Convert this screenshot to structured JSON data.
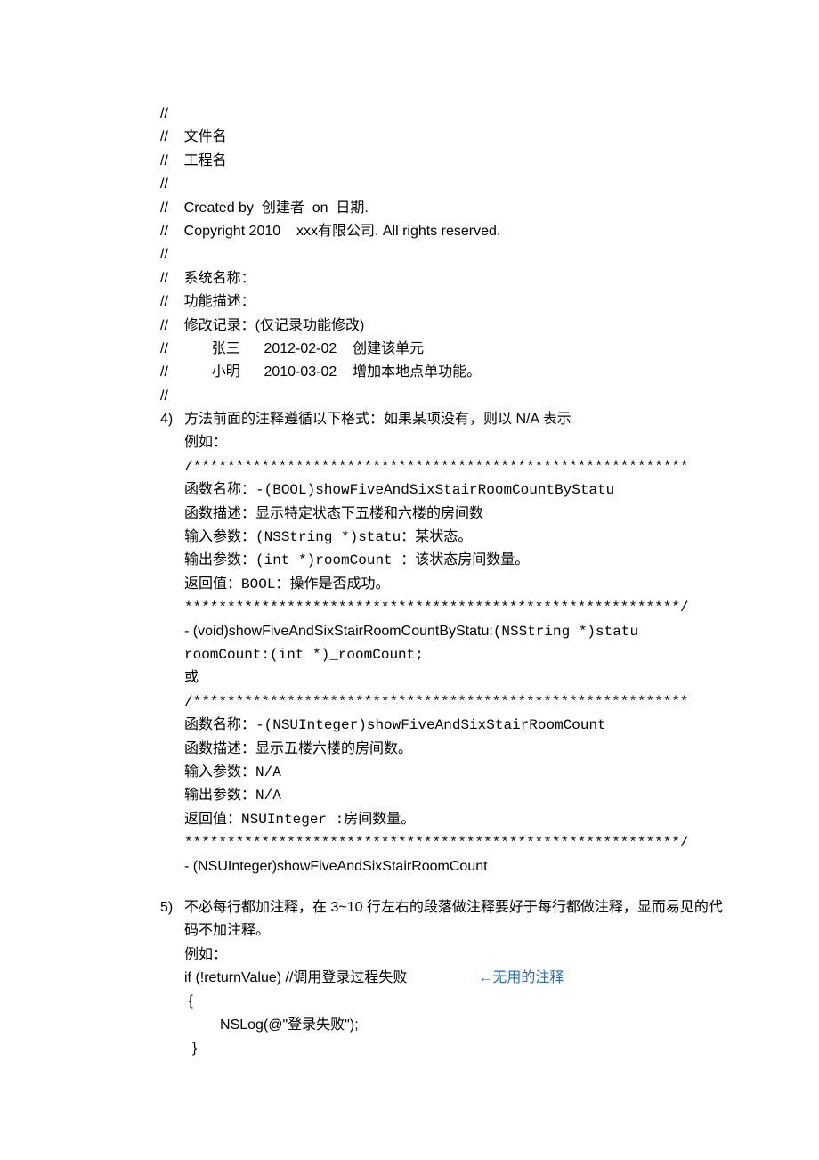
{
  "header": {
    "l1": "//",
    "l2": "//    文件名",
    "l3": "//    工程名",
    "l4": "//",
    "l5": "//    Created by  创建者  on  日期.",
    "l6": "//    Copyright 2010    xxx有限公司. All rights reserved.",
    "l7": "//",
    "l8": "//    系统名称：",
    "l9": "//    功能描述：",
    "l10": "//    修改记录：(仅记录功能修改)",
    "l11": "//           张三      2012-02-02    创建该单元",
    "l12": "//           小明      2010-03-02    增加本地点单功能。",
    "l13": "//"
  },
  "item4": {
    "num": "4)",
    "l1": "方法前面的注释遵循以下格式：如果某项没有，则以 N/A 表示",
    "l2": "例如：",
    "l3": "/**********************************************************",
    "l4a": " 函数名称：",
    "l4b": "-(BOOL)showFiveAndSixStairRoomCountByStatu",
    "l5": " 函数描述：显示特定状态下五楼和六楼的房间数",
    "l6a": " 输入参数：",
    "l6b": "(NSString *)statu：",
    "l6c": "某状态。",
    "l7a": " 输出参数：",
    "l7b": "(int *)roomCount ：",
    "l7c": "该状态房间数量。",
    "l8a": " 返回值：",
    "l8b": "BOOL：",
    "l8c": "操作是否成功。",
    "l9": "**********************************************************/",
    "l10a": " - (void)showFiveAndSixStairRoomCountByStatu:",
    "l10b": "(NSString *)statu",
    "l11": "   roomCount:(int *)_roomCount;",
    "l12": " 或",
    "l13": "/**********************************************************",
    "l14a": " 函数名称：",
    "l14b": "-(NSUInteger)showFiveAndSixStairRoomCount",
    "l15": " 函数描述：显示五楼六楼的房间数。",
    "l16a": " 输入参数：",
    "l16b": "N/A",
    "l17a": " 输出参数：",
    "l17b": "N/A",
    "l18a": " 返回值：",
    "l18b": "NSUInteger :",
    "l18c": "房间数量。",
    "l19": "**********************************************************/",
    "l20": " - (NSUInteger)showFiveAndSixStairRoomCount"
  },
  "item5": {
    "num": "5)",
    "l1": "不必每行都加注释，在 3~10 行左右的段落做注释要好于每行都做注释，显而易见的代码不加注释。",
    "l2": "例如：",
    "l3a": "if (!returnValue)           //调用登录过程失败",
    "l3b": "←无用的注释",
    "l4": " {",
    "l5": "         NSLog(@\"登录失败\");",
    "l6": "  }"
  }
}
